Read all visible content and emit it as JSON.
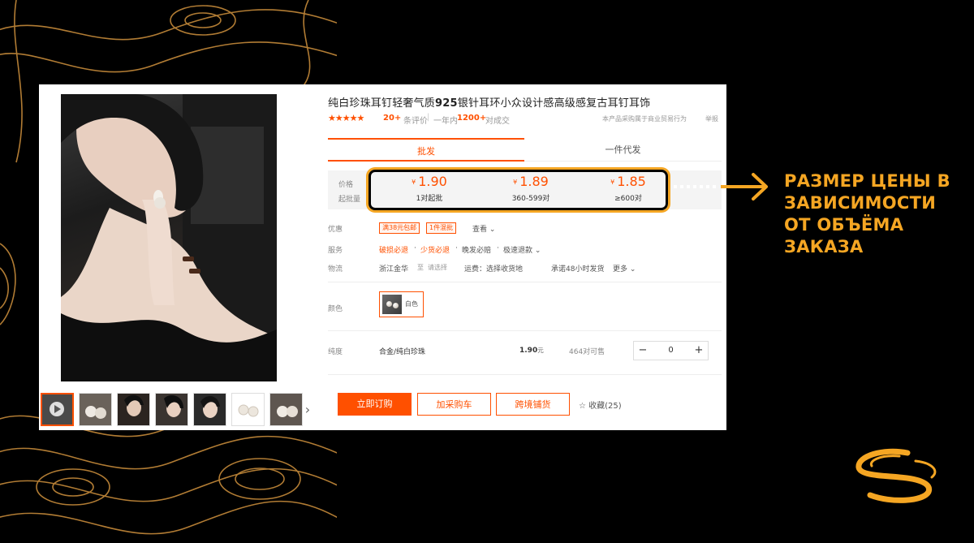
{
  "product": {
    "title_pre": "纯白珍珠耳钉轻奢气质",
    "title_num": "925",
    "title_post": "银针耳环小众设计感高级感复古耳钉耳饰",
    "stars": "★★★★★",
    "reviews_count": "20+",
    "reviews_label": "条评价",
    "sep": "|",
    "year_label": "一年内",
    "year_count": "1200+",
    "year_suffix": "对成交",
    "trade_note": "本产品采购属于商业贸易行为",
    "report": "举报"
  },
  "tabs": {
    "wholesale": "批发",
    "dropship": "一件代发"
  },
  "prices": {
    "label_price": "价格",
    "label_moq": "起批量",
    "currency": "¥",
    "tiers": [
      {
        "price": "1.90",
        "qty": "1对起批"
      },
      {
        "price": "1.89",
        "qty": "360-599对"
      },
      {
        "price": "1.85",
        "qty": "≥600对"
      }
    ]
  },
  "promo": {
    "label": "优惠",
    "tag1": "满38元包邮",
    "tag2": "1件混批",
    "more": "查看"
  },
  "service": {
    "label": "服务",
    "item1": "破损必退",
    "item2": "少货必退",
    "item3": "晚发必赔",
    "item4": "极速退款"
  },
  "logistics": {
    "label": "物流",
    "from": "浙江金华",
    "to": "至",
    "select": "请选择",
    "fee": "运费：选择收货地",
    "promise": "承诺48小时发货",
    "more": "更多"
  },
  "color": {
    "label": "颜色",
    "option": "白色"
  },
  "spec": {
    "label": "纯度",
    "name": "合金/纯白珍珠",
    "price": "1.90",
    "unit": "元",
    "stock": "464对可售",
    "minus": "−",
    "qty": "0",
    "plus": "+"
  },
  "actions": {
    "buy": "立即订购",
    "cart": "加采购车",
    "cross": "跨境铺货",
    "fav": "收藏(25)"
  },
  "thumbs": {
    "next": "›"
  },
  "annotation": {
    "line1": "РАЗМЕР ЦЕНЫ В",
    "line2": "ЗАВИСИМОСТИ",
    "line3": "ОТ ОБЪЁМА",
    "line4": "ЗАКАЗА"
  },
  "colors": {
    "accent": "#ff5000",
    "annotation": "#f5a623",
    "background": "#000000"
  }
}
